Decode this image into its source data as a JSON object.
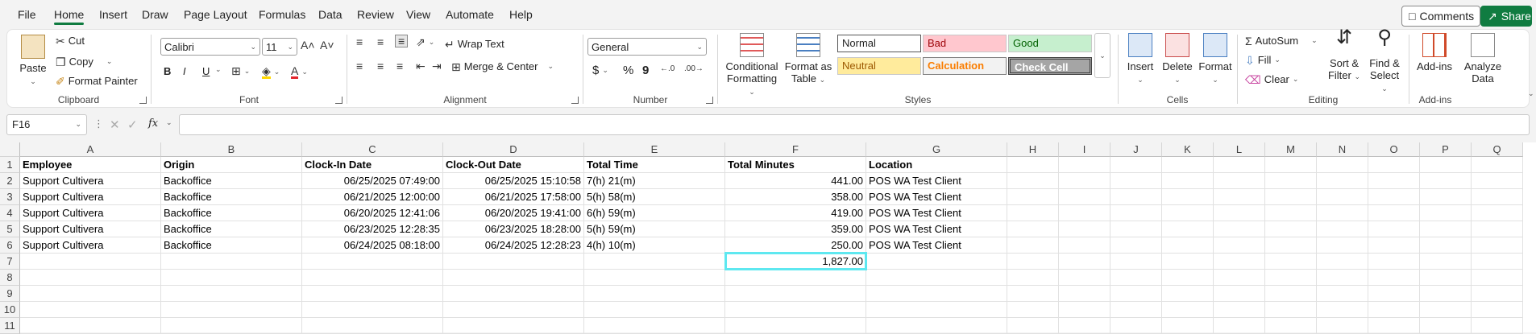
{
  "menu": {
    "tabs": [
      "File",
      "Home",
      "Insert",
      "Draw",
      "Page Layout",
      "Formulas",
      "Data",
      "Review",
      "View",
      "Automate",
      "Help"
    ],
    "comments": "Comments",
    "share": "Share"
  },
  "ribbon": {
    "clipboard": {
      "label": "Clipboard",
      "paste": "Paste",
      "cut": "Cut",
      "copy": "Copy",
      "format_painter": "Format Painter"
    },
    "font": {
      "label": "Font",
      "name": "Calibri",
      "size": "11",
      "bold": "B",
      "italic": "I",
      "underline": "U"
    },
    "alignment": {
      "label": "Alignment",
      "wrap": "Wrap Text",
      "merge": "Merge & Center"
    },
    "number": {
      "label": "Number",
      "format": "General",
      "currency": "$",
      "percent": "%",
      "comma": "9"
    },
    "styles": {
      "label": "Styles",
      "conditional": "Conditional Formatting",
      "format_table": "Format as Table",
      "normal": "Normal",
      "bad": "Bad",
      "good": "Good",
      "neutral": "Neutral",
      "calculation": "Calculation",
      "check": "Check Cell"
    },
    "cells": {
      "label": "Cells",
      "insert": "Insert",
      "delete": "Delete",
      "format": "Format"
    },
    "editing": {
      "label": "Editing",
      "autosum": "AutoSum",
      "fill": "Fill",
      "clear": "Clear",
      "sort": "Sort & Filter",
      "find": "Find & Select"
    },
    "addins": {
      "label": "Add-ins",
      "addins": "Add-ins",
      "analyze": "Analyze Data"
    }
  },
  "formula_bar": {
    "namebox": "F16",
    "fx": "fx",
    "formula": ""
  },
  "sheet": {
    "columns": [
      "A",
      "B",
      "C",
      "D",
      "E",
      "F",
      "G",
      "H",
      "I",
      "J",
      "K",
      "L",
      "M",
      "N",
      "O",
      "P",
      "Q"
    ],
    "rows": [
      "1",
      "2",
      "3",
      "4",
      "5",
      "6",
      "7",
      "8",
      "9",
      "10",
      "11"
    ],
    "header": [
      "Employee",
      "Origin",
      "Clock-In Date",
      "Clock-Out Date",
      "Total Time",
      "Total Minutes",
      "Location"
    ],
    "data": [
      [
        "Support Cultivera",
        "Backoffice",
        "06/25/2025 07:49:00",
        "06/25/2025 15:10:58",
        "7(h) 21(m)",
        "441.00",
        "POS WA Test Client"
      ],
      [
        "Support Cultivera",
        "Backoffice",
        "06/21/2025 12:00:00",
        "06/21/2025 17:58:00",
        "5(h) 58(m)",
        "358.00",
        "POS WA Test Client"
      ],
      [
        "Support Cultivera",
        "Backoffice",
        "06/20/2025 12:41:06",
        "06/20/2025 19:41:00",
        "6(h) 59(m)",
        "419.00",
        "POS WA Test Client"
      ],
      [
        "Support Cultivera",
        "Backoffice",
        "06/23/2025 12:28:35",
        "06/23/2025 18:28:00",
        "5(h) 59(m)",
        "359.00",
        "POS WA Test Client"
      ],
      [
        "Support Cultivera",
        "Backoffice",
        "06/24/2025 08:18:00",
        "06/24/2025 12:28:23",
        "4(h) 10(m)",
        "250.00",
        "POS WA Test Client"
      ]
    ],
    "total": "1,827.00"
  }
}
